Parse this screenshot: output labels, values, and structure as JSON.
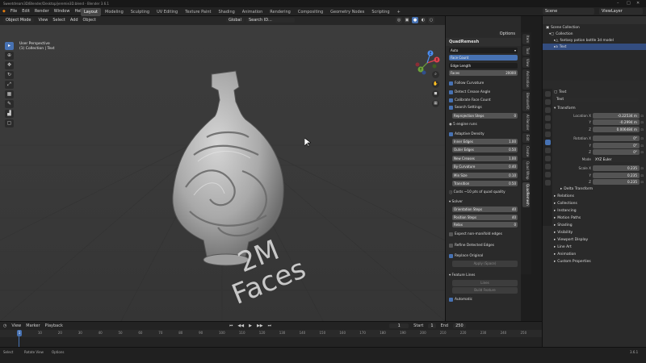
{
  "window": {
    "title": "Sweetdream3D/Blender/Desktop/jeremie3D.blend - Blender 3.6.1",
    "controls": [
      "–",
      "□",
      "✕"
    ]
  },
  "menubar": {
    "logo": "◆",
    "menus": [
      "File",
      "Edit",
      "Render",
      "Window",
      "Help"
    ],
    "workspaces": [
      "Layout",
      "Modeling",
      "Sculpting",
      "UV Editing",
      "Texture Paint",
      "Shading",
      "Animation",
      "Rendering",
      "Compositing",
      "Geometry Nodes",
      "Scripting",
      "+"
    ],
    "active_workspace": "Layout",
    "scene": "Scene",
    "view_layer": "ViewLayer"
  },
  "viewport": {
    "mode": "Object Mode",
    "menus": [
      "View",
      "Select",
      "Add",
      "Object"
    ],
    "orientation": "Global",
    "search_placeholder": "Search ID...",
    "info_line1": "User Perspective",
    "info_line2": "(1) Collection | Text",
    "overlay_line1": "2M",
    "overlay_line2": "Faces",
    "gizmo_axes": [
      "X",
      "Y",
      "Z"
    ],
    "options_label": "Options"
  },
  "quadremesh": {
    "header": "QuadRemesh",
    "mode_dropdown": "Auto",
    "options": [
      "Face Count",
      "Edge Length"
    ],
    "selected_option": "Face Count",
    "faces_label": "Faces",
    "faces_value": "20000",
    "follow_curvature": "Follow Curvature",
    "detect_crease": "Detect Crease Angle",
    "calibrate": "Calibrate Face Count",
    "search_settings": "Search Settings",
    "reprojection_label": "Reprojection Steps",
    "reprojection_value": "0",
    "engine_runs": "5 engine runs",
    "adaptive_density": "Adaptive Density",
    "inner_edges_label": "Inner Edges",
    "inner_edges_value": "1.00",
    "outer_edges_label": "Outer Edges",
    "outer_edges_value": "0.50",
    "new_creases_label": "New Creases",
    "new_creases_value": "1.00",
    "by_curvature_label": "By Curvature",
    "by_curvature_value": "0.40",
    "min_size_label": "Min Size",
    "min_size_value": "0.10",
    "transition_label": "Transition",
    "transition_value": "0.50",
    "costs_note": "Costs ~10 pts of quad quality",
    "solver": "Solver",
    "orientation_label": "Orientation Steps",
    "orientation_value": "40",
    "position_label": "Position Steps",
    "position_value": "40",
    "relax_label": "Relax",
    "relax_value": "0",
    "expect_nonmanifold": "Expect non-manifold edges",
    "refine_detected": "Refine Detected Edges",
    "replace_original": "Replace Original",
    "apply_button": "Apply (Space)",
    "feature_lines": "Feature Lines",
    "lines_button": "Lines",
    "build_button": "Build Feature",
    "automatic": "Automatic"
  },
  "sidetabs": [
    "Item",
    "Tool",
    "View",
    "Animation",
    "BlenderKit",
    "AI Render",
    "Edit",
    "Create",
    "Quad Wrap",
    "QuadRemesh"
  ],
  "outliner": {
    "title": "Scene Collection",
    "items": [
      "Collection",
      "fantasy potion bottle 3d model",
      "Text"
    ]
  },
  "properties": {
    "object_name": "Text",
    "object_field": "Text",
    "transform": "Transform",
    "location_x": "-0.22534 m",
    "location_y": "-0.2994 m",
    "location_z": "0.006484 m",
    "rotation_x": "0°",
    "rotation_y": "0°",
    "rotation_z": "0°",
    "mode_label": "Mode",
    "mode_value": "XYZ Euler",
    "scale_x": "0.235",
    "scale_y": "0.235",
    "scale_z": "0.235",
    "labels": {
      "location": "Location X",
      "y": "Y",
      "z": "Z",
      "rotation": "Rotation X",
      "scale": "Scale X"
    },
    "sections": [
      "Delta Transform",
      "Relations",
      "Collections",
      "Instancing",
      "Motion Paths",
      "Shading",
      "Visibility",
      "Viewport Display",
      "Line Art",
      "Animation",
      "Custom Properties"
    ]
  },
  "timeline": {
    "menus": [
      "View",
      "Marker",
      "Playback"
    ],
    "current_frame": "1",
    "start_label": "Start",
    "start_value": "1",
    "end_label": "End",
    "end_value": "250",
    "ruler": [
      "1",
      "10",
      "20",
      "30",
      "40",
      "50",
      "60",
      "70",
      "80",
      "90",
      "100",
      "110",
      "120",
      "130",
      "140",
      "150",
      "160",
      "170",
      "180",
      "190",
      "200",
      "210",
      "220",
      "230",
      "240",
      "250"
    ]
  },
  "status": {
    "left": "Select",
    "middle": "Rotate View",
    "right": "Options",
    "version": "3.6.1"
  }
}
